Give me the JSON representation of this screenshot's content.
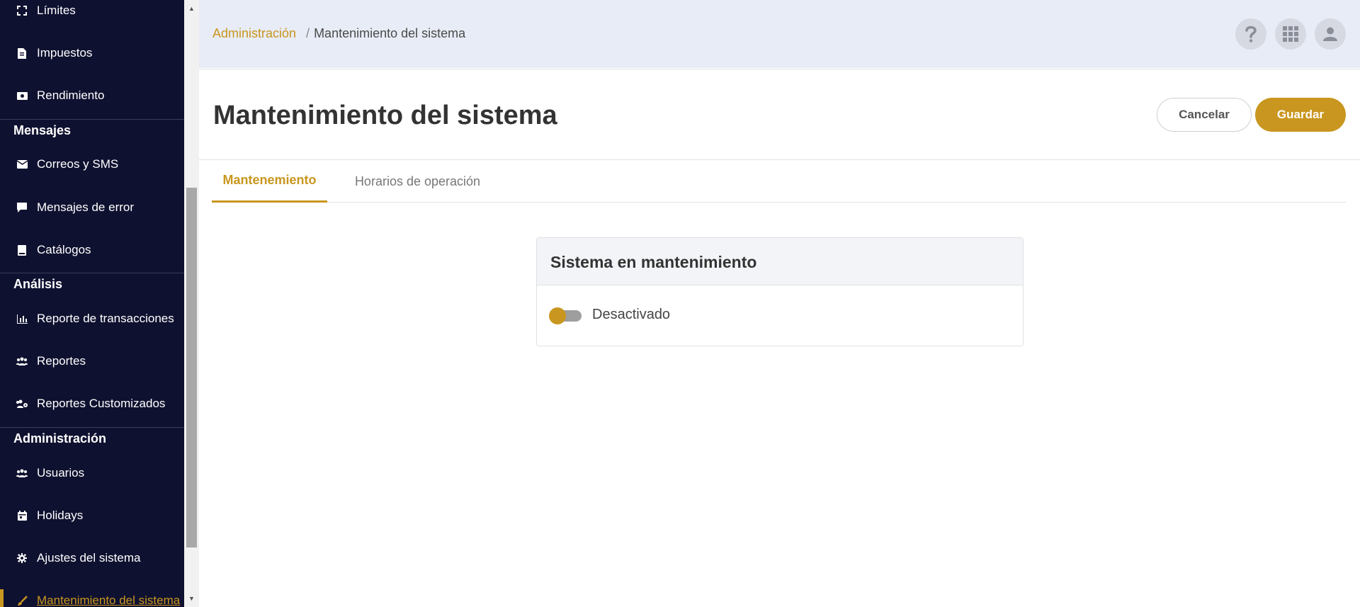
{
  "colors": {
    "accent": "#c9961f",
    "sidebar_bg": "#0f1130",
    "topbar_bg": "#e8ecf6"
  },
  "sidebar": {
    "items_top": [
      {
        "label": "Límites",
        "icon": "expand-icon"
      },
      {
        "label": "Impuestos",
        "icon": "document-icon"
      },
      {
        "label": "Rendimiento",
        "icon": "money-icon"
      }
    ],
    "sections": [
      {
        "title": "Mensajes",
        "items": [
          {
            "label": "Correos y SMS",
            "icon": "envelope-icon"
          },
          {
            "label": "Mensajes de error",
            "icon": "comment-icon"
          },
          {
            "label": "Catálogos",
            "icon": "book-icon"
          }
        ]
      },
      {
        "title": "Análisis",
        "items": [
          {
            "label": "Reporte de transacciones",
            "icon": "chart-icon"
          },
          {
            "label": "Reportes",
            "icon": "users-icon"
          },
          {
            "label": "Reportes Customizados",
            "icon": "users-cog-icon"
          }
        ]
      },
      {
        "title": "Administración",
        "items": [
          {
            "label": "Usuarios",
            "icon": "users-icon"
          },
          {
            "label": "Holidays",
            "icon": "calendar-icon"
          },
          {
            "label": "Ajustes del sistema",
            "icon": "gear-icon"
          },
          {
            "label": "Mantenimiento del sistema",
            "icon": "brush-icon",
            "active": true
          }
        ]
      }
    ]
  },
  "topbar": {
    "breadcrumb": {
      "parent": "Administración",
      "separator": "/",
      "current": "Mantenimiento del sistema"
    },
    "icons": [
      "help-icon",
      "apps-grid-icon",
      "user-icon"
    ]
  },
  "header": {
    "title": "Mantenimiento del sistema",
    "cancel_label": "Cancelar",
    "save_label": "Guardar"
  },
  "tabs": [
    {
      "label": "Mantenemiento",
      "active": true
    },
    {
      "label": "Horarios de operación",
      "active": false
    }
  ],
  "maintenance_card": {
    "title": "Sistema en mantenimiento",
    "toggle_label": "Desactivado",
    "toggle_on": false
  }
}
